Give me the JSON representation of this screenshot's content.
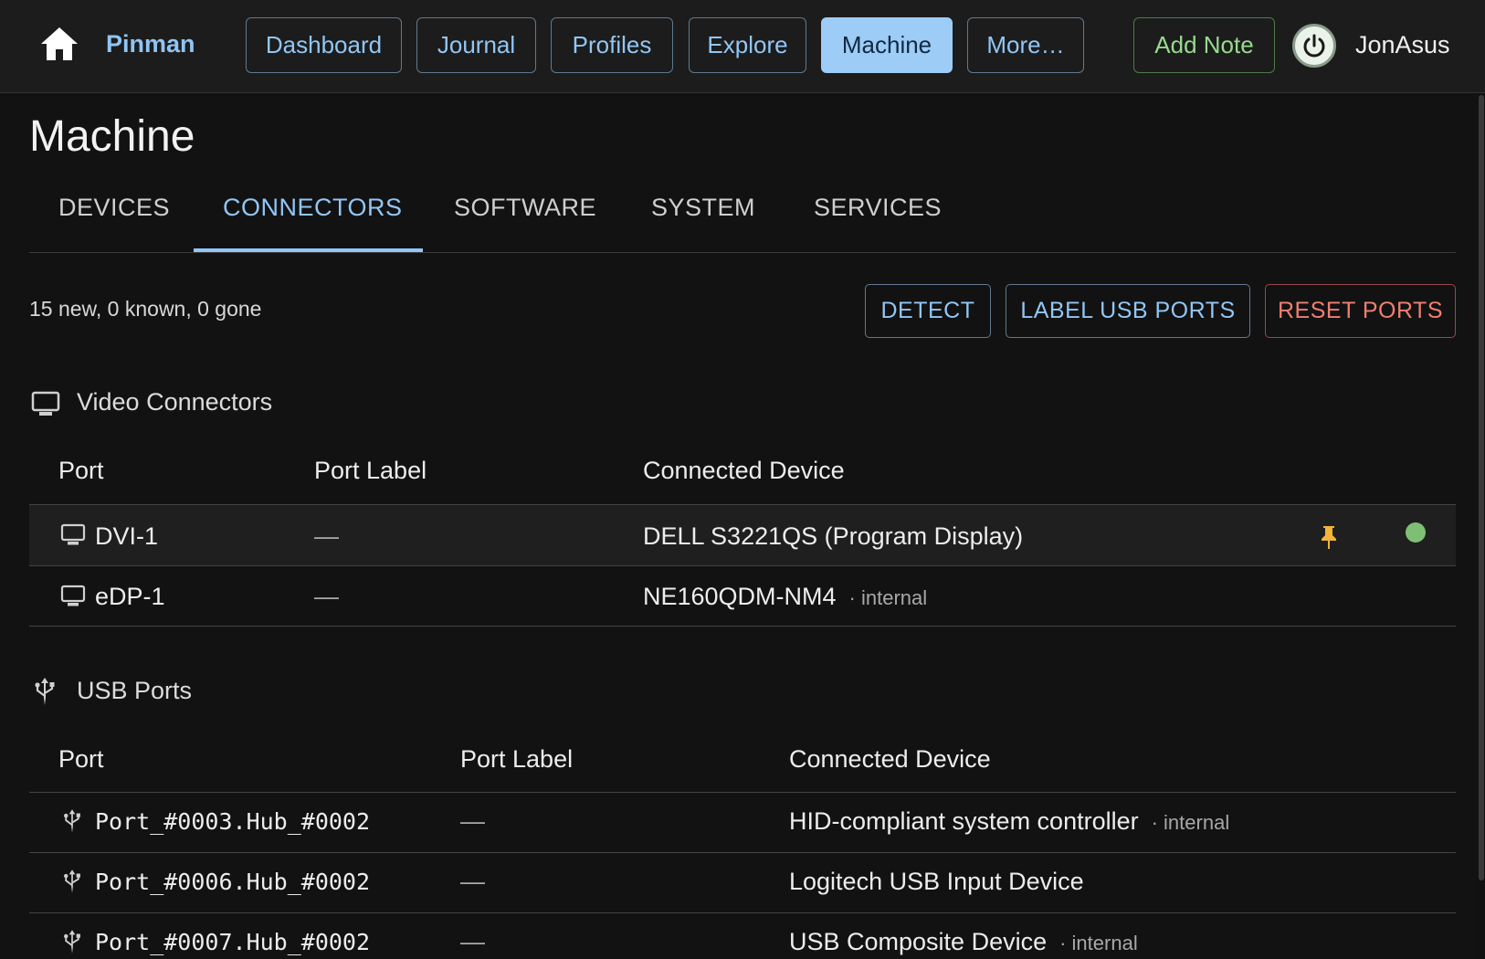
{
  "header": {
    "brand": "Pinman",
    "nav": [
      "Dashboard",
      "Journal",
      "Profiles",
      "Explore",
      "Machine",
      "More…"
    ],
    "active_nav": "Machine",
    "add_note": "Add Note",
    "user": "JonAsus",
    "icons": {
      "home": "home-icon",
      "power": "power-icon"
    }
  },
  "page": {
    "title": "Machine"
  },
  "tabs": [
    "DEVICES",
    "CONNECTORS",
    "SOFTWARE",
    "SYSTEM",
    "SERVICES"
  ],
  "active_tab": "CONNECTORS",
  "summary": "15 new, 0 known, 0 gone",
  "actions": {
    "detect": "DETECT",
    "label_usb": "LABEL USB PORTS",
    "reset": "RESET PORTS"
  },
  "video": {
    "title": "Video Connectors",
    "icon": "monitor-icon",
    "columns": [
      "Port",
      "Port Label",
      "Connected Device"
    ],
    "rows": [
      {
        "port": "DVI-1",
        "label": "—",
        "device": "DELL S3221QS (Program Display)",
        "tag": "",
        "pinned": true,
        "status": "connected"
      },
      {
        "port": "eDP-1",
        "label": "—",
        "device": "NE160QDM-NM4",
        "tag": "· internal"
      }
    ]
  },
  "usb": {
    "title": "USB Ports",
    "icon": "usb-icon",
    "columns": [
      "Port",
      "Port Label",
      "Connected Device"
    ],
    "rows": [
      {
        "port": "Port_#0003.Hub_#0002",
        "label": "—",
        "device": "HID-compliant system controller",
        "tag": "· internal"
      },
      {
        "port": "Port_#0006.Hub_#0002",
        "label": "—",
        "device": "Logitech USB Input Device",
        "tag": ""
      },
      {
        "port": "Port_#0007.Hub_#0002",
        "label": "—",
        "device": "USB Composite Device",
        "tag": "· internal"
      }
    ]
  },
  "colors": {
    "accent": "#92c6f5",
    "active_button_bg": "#9dccf6",
    "note_green": "#98d98e",
    "danger": "#f07f72",
    "pin": "#f2b43a",
    "status_ok": "#7fbf74"
  }
}
